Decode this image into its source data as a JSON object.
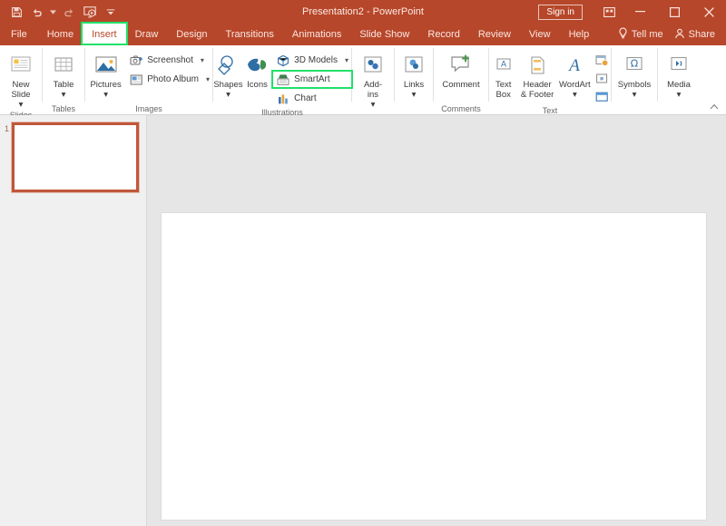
{
  "titlebar": {
    "document_title": "Presentation2  -  PowerPoint",
    "signin_label": "Sign in",
    "quick_access": [
      {
        "name": "save-icon",
        "label": "Save"
      },
      {
        "name": "undo-icon",
        "label": "Undo"
      },
      {
        "name": "redo-icon",
        "label": "Redo"
      },
      {
        "name": "start-from-beginning-icon",
        "label": "Start From Beginning"
      },
      {
        "name": "customize-quick-access-toolbar-icon",
        "label": "Customize Quick Access Toolbar"
      }
    ],
    "window_controls": [
      {
        "name": "ribbon-display-options",
        "label": "Ribbon Display Options"
      },
      {
        "name": "minimize",
        "label": "Minimize"
      },
      {
        "name": "maximize",
        "label": "Maximize"
      },
      {
        "name": "close",
        "label": "Close"
      }
    ]
  },
  "tabs": [
    {
      "label": "File",
      "active": false
    },
    {
      "label": "Home",
      "active": false
    },
    {
      "label": "Insert",
      "active": true,
      "highlighted": true
    },
    {
      "label": "Draw",
      "active": false
    },
    {
      "label": "Design",
      "active": false
    },
    {
      "label": "Transitions",
      "active": false
    },
    {
      "label": "Animations",
      "active": false
    },
    {
      "label": "Slide Show",
      "active": false
    },
    {
      "label": "Record",
      "active": false
    },
    {
      "label": "Review",
      "active": false
    },
    {
      "label": "View",
      "active": false
    },
    {
      "label": "Help",
      "active": false
    }
  ],
  "tab_right": {
    "tell_me_label": "Tell me",
    "share_label": "Share"
  },
  "ribbon": {
    "collapse_label": "Collapse the Ribbon",
    "groups": [
      {
        "label": "Slides",
        "big_buttons": [
          {
            "name": "new-slide-button",
            "label": "New\nSlide",
            "caret": true,
            "icon": "new-slide-icon"
          }
        ],
        "small_buttons": [],
        "tiny_buttons": []
      },
      {
        "label": "Tables",
        "big_buttons": [
          {
            "name": "table-button",
            "label": "Table",
            "caret": true,
            "icon": "table-icon"
          }
        ],
        "small_buttons": [],
        "tiny_buttons": []
      },
      {
        "label": "Images",
        "big_buttons": [
          {
            "name": "pictures-button",
            "label": "Pictures",
            "caret": true,
            "icon": "pictures-icon"
          }
        ],
        "small_buttons": [
          {
            "name": "screenshot-button",
            "label": "Screenshot",
            "caret": true,
            "icon": "screenshot-icon",
            "highlighted": false
          },
          {
            "name": "photo-album-button",
            "label": "Photo Album",
            "caret": true,
            "icon": "photo-album-icon",
            "highlighted": false
          }
        ],
        "tiny_buttons": []
      },
      {
        "label": "Illustrations",
        "big_buttons": [
          {
            "name": "shapes-button",
            "label": "Shapes",
            "caret": true,
            "icon": "shapes-icon"
          },
          {
            "name": "icons-button",
            "label": "Icons",
            "caret": false,
            "icon": "icons-icon"
          }
        ],
        "small_buttons": [
          {
            "name": "3d-models-button",
            "label": "3D Models",
            "caret": true,
            "icon": "3d-models-icon",
            "highlighted": false
          },
          {
            "name": "smartart-button",
            "label": "SmartArt",
            "caret": false,
            "icon": "smartart-icon",
            "highlighted": true
          },
          {
            "name": "chart-button",
            "label": "Chart",
            "caret": false,
            "icon": "chart-icon",
            "highlighted": false
          }
        ],
        "tiny_buttons": []
      },
      {
        "label": "",
        "big_buttons": [
          {
            "name": "add-ins-button",
            "label": "Add-\nins",
            "caret": true,
            "icon": "add-ins-icon"
          }
        ],
        "small_buttons": [],
        "tiny_buttons": []
      },
      {
        "label": "",
        "big_buttons": [
          {
            "name": "links-button",
            "label": "Links",
            "caret": true,
            "icon": "links-icon"
          }
        ],
        "small_buttons": [],
        "tiny_buttons": []
      },
      {
        "label": "Comments",
        "big_buttons": [
          {
            "name": "comment-button",
            "label": "Comment",
            "caret": false,
            "icon": "comment-icon"
          }
        ],
        "small_buttons": [],
        "tiny_buttons": []
      },
      {
        "label": "Text",
        "big_buttons": [
          {
            "name": "text-box-button",
            "label": "Text\nBox",
            "caret": false,
            "icon": "text-box-icon"
          },
          {
            "name": "header-footer-button",
            "label": "Header\n& Footer",
            "caret": false,
            "icon": "header-footer-icon"
          },
          {
            "name": "wordart-button",
            "label": "WordArt",
            "caret": true,
            "icon": "wordart-icon"
          }
        ],
        "small_buttons": [],
        "tiny_buttons": [
          {
            "name": "date-and-time-button",
            "label": "Date & Time",
            "icon": "date-time-icon"
          },
          {
            "name": "slide-number-button",
            "label": "Slide Number",
            "icon": "slide-number-icon"
          },
          {
            "name": "object-button",
            "label": "Object",
            "icon": "object-icon"
          }
        ]
      },
      {
        "label": "",
        "big_buttons": [
          {
            "name": "symbols-button",
            "label": "Symbols",
            "caret": true,
            "icon": "symbols-icon"
          }
        ],
        "small_buttons": [],
        "tiny_buttons": []
      },
      {
        "label": "",
        "big_buttons": [
          {
            "name": "media-button",
            "label": "Media",
            "caret": true,
            "icon": "media-icon"
          }
        ],
        "small_buttons": [],
        "tiny_buttons": []
      }
    ]
  },
  "thumbnail_pane": {
    "slides": [
      {
        "number": "1",
        "selected": true
      }
    ]
  },
  "colors": {
    "brand": "#b7472a",
    "highlight": "#22e06a",
    "slide_selection": "#c0563a",
    "workspace": "#e6e6e6"
  }
}
